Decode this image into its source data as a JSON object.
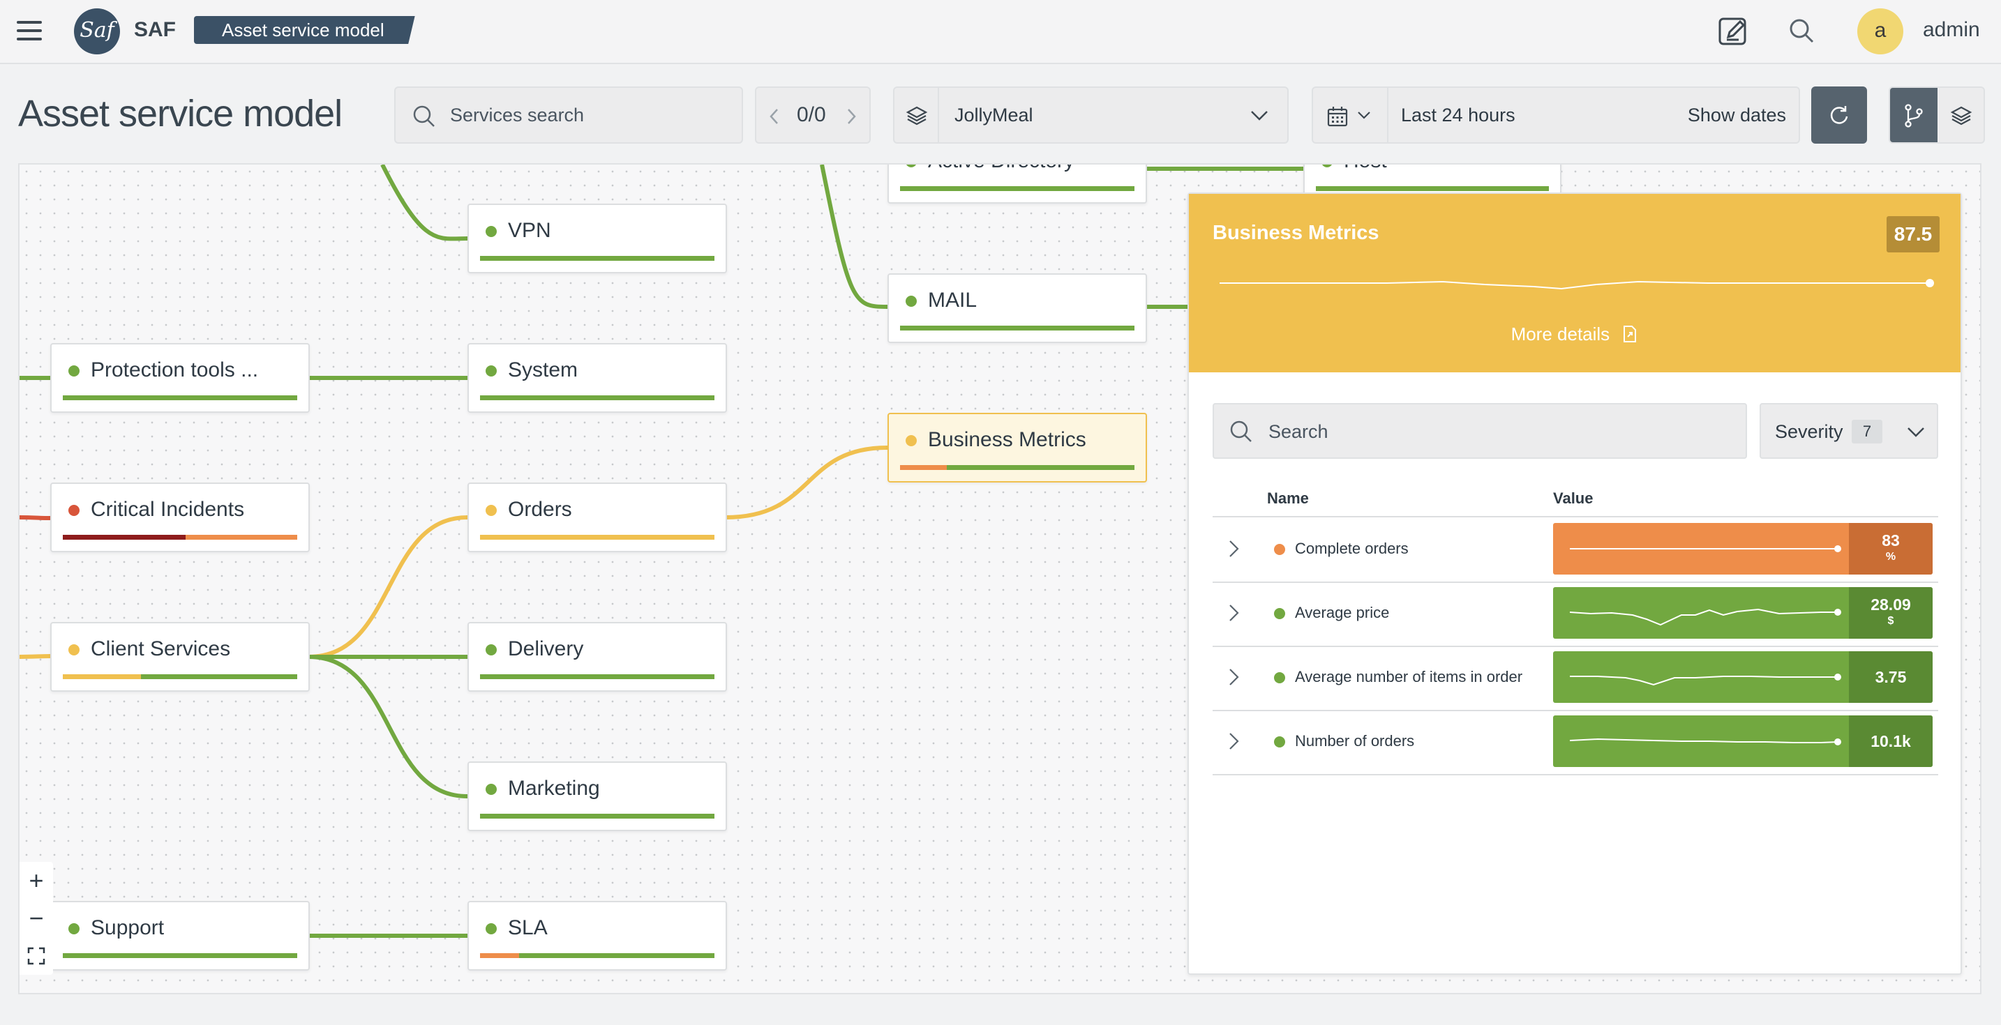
{
  "header": {
    "app_name": "SAF",
    "logo_text": "Saf",
    "breadcrumb": "Asset service model",
    "avatar_letter": "a",
    "username": "admin"
  },
  "toolbar": {
    "page_title": "Asset service model",
    "search_placeholder": "Services search",
    "pager_text": "0/0",
    "service_selected": "JollyMeal",
    "time_range": "Last 24 hours",
    "show_dates_label": "Show dates"
  },
  "nodes": [
    {
      "key": "active-directory",
      "label": "Active Directory",
      "status": "green"
    },
    {
      "key": "host",
      "label": "Host",
      "status": "green"
    },
    {
      "key": "vpn",
      "label": "VPN",
      "status": "green"
    },
    {
      "key": "mail",
      "label": "MAIL",
      "status": "green"
    },
    {
      "key": "protection-tools",
      "label": "Protection tools ...",
      "status": "green"
    },
    {
      "key": "system",
      "label": "System",
      "status": "green"
    },
    {
      "key": "business-metrics",
      "label": "Business Metrics",
      "status": "yellow"
    },
    {
      "key": "critical-incidents",
      "label": "Critical Incidents",
      "status": "red"
    },
    {
      "key": "orders",
      "label": "Orders",
      "status": "yellow"
    },
    {
      "key": "client-services",
      "label": "Client Services",
      "status": "yellow"
    },
    {
      "key": "delivery",
      "label": "Delivery",
      "status": "green"
    },
    {
      "key": "marketing",
      "label": "Marketing",
      "status": "green"
    },
    {
      "key": "support",
      "label": "Support",
      "status": "green"
    },
    {
      "key": "sla",
      "label": "SLA",
      "status": "green"
    }
  ],
  "zoom_controls": {
    "zoom_in": "+",
    "zoom_out": "−"
  },
  "panel": {
    "title": "Business Metrics",
    "score": "87.5",
    "more_details_label": "More details",
    "search_placeholder": "Search",
    "severity_label": "Severity",
    "severity_count": "7",
    "col_name": "Name",
    "col_value": "Value",
    "metrics": [
      {
        "name": "Complete orders",
        "value": "83",
        "unit": "%",
        "status": "orange"
      },
      {
        "name": "Average price",
        "value": "28.09",
        "unit": "$",
        "status": "green"
      },
      {
        "name": "Average number of items in order",
        "value": "3.75",
        "unit": "",
        "status": "green"
      },
      {
        "name": "Number of orders",
        "value": "10.1k",
        "unit": "",
        "status": "green"
      }
    ]
  },
  "colors": {
    "green": "#72a840",
    "green_dark": "#5a8a33",
    "yellow": "#f0c04f",
    "orange": "#ee8d4a",
    "orange_dark": "#c96d34",
    "red": "#d8553a",
    "dark_red": "#8e1c1c",
    "header_blue": "#3b5166"
  }
}
